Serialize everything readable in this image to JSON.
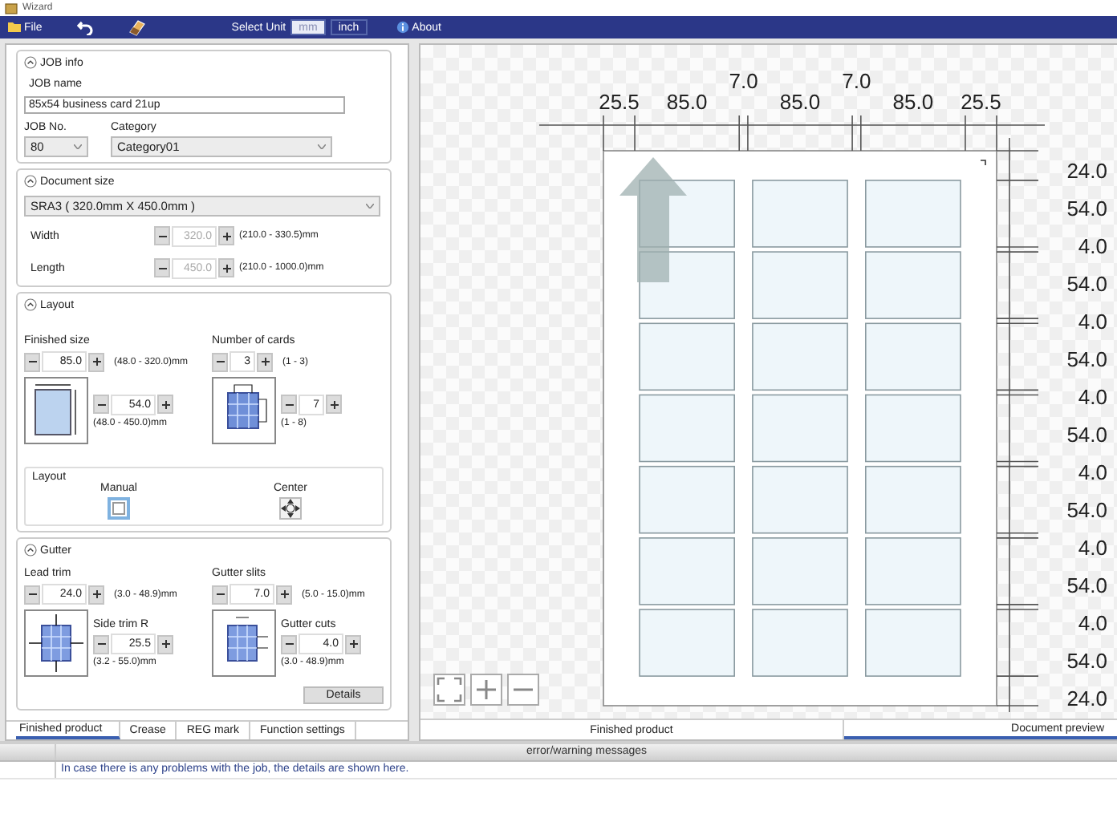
{
  "window": {
    "title": "Wizard"
  },
  "toolbar": {
    "file": "File",
    "unit_label": "Select Unit",
    "units": [
      {
        "label": "mm",
        "selected": true
      },
      {
        "label": "inch",
        "selected": false
      }
    ],
    "about": "About"
  },
  "job_info": {
    "title": "JOB info",
    "job_name_label": "JOB name",
    "job_name": "85x54 business card 21up",
    "job_no_label": "JOB No.",
    "job_no": "80",
    "category_label": "Category",
    "category": "Category01"
  },
  "document_size": {
    "title": "Document size",
    "paper": "SRA3 ( 320.0mm X 450.0mm )",
    "fields": [
      {
        "label": "Width",
        "value": "320.0",
        "range": "(210.0 - 330.5)mm",
        "disabled": true
      },
      {
        "label": "Length",
        "value": "450.0",
        "range": "(210.0 - 1000.0)mm",
        "disabled": true
      }
    ]
  },
  "layout": {
    "title": "Layout",
    "finished_size_label": "Finished size",
    "width": {
      "value": "85.0",
      "range": "(48.0 - 320.0)mm"
    },
    "height": {
      "value": "54.0",
      "range": "(48.0 - 450.0)mm"
    },
    "cards_label": "Number of cards",
    "across": {
      "value": "3",
      "range": "(1 - 3)"
    },
    "down": {
      "value": "7",
      "range": "(1 - 8)"
    },
    "group_label": "Layout",
    "options": [
      {
        "kind": "manual",
        "label": "Manual",
        "selected": true
      },
      {
        "kind": "center",
        "label": "Center",
        "selected": false
      }
    ]
  },
  "gutter": {
    "title": "Gutter",
    "lead_trim": {
      "label": "Lead trim",
      "value": "24.0",
      "range": "(3.0 - 48.9)mm"
    },
    "side_trim": {
      "label": "Side trim R",
      "value": "25.5",
      "range": "(3.2 - 55.0)mm"
    },
    "gutter_slits": {
      "label": "Gutter slits",
      "value": "7.0",
      "range": "(5.0 - 15.0)mm"
    },
    "gutter_cuts": {
      "label": "Gutter cuts",
      "value": "4.0",
      "range": "(3.0 - 48.9)mm"
    },
    "details": "Details"
  },
  "left_tabs": [
    {
      "label": "Finished product",
      "selected": true
    },
    {
      "label": "Crease",
      "selected": false
    },
    {
      "label": "REG mark",
      "selected": false
    },
    {
      "label": "Function settings",
      "selected": false
    }
  ],
  "preview": {
    "top_labels": [
      "25.5",
      "85.0",
      "7.0",
      "85.0",
      "7.0",
      "85.0",
      "25.5"
    ],
    "right_labels": [
      "24.0",
      "54.0",
      "4.0",
      "54.0",
      "4.0",
      "54.0",
      "4.0",
      "54.0",
      "4.0",
      "54.0",
      "4.0",
      "54.0",
      "4.0",
      "54.0",
      "24.0"
    ]
  },
  "preview_tabs": [
    {
      "label": "Finished product",
      "selected": false
    },
    {
      "label": "Document preview",
      "selected": true
    }
  ],
  "messages": {
    "header": "error/warning messages",
    "rows": [
      "In case there is any problems with the job, the details are shown here."
    ]
  }
}
